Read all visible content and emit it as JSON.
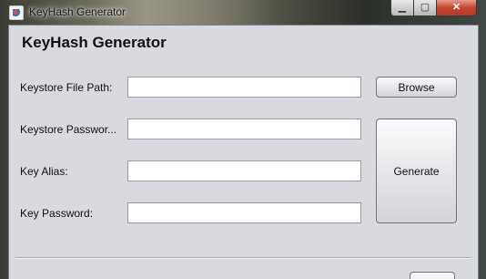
{
  "window": {
    "title": "KeyHash Generator",
    "controls": {
      "minimize": "▁",
      "maximize": "▢",
      "close": "✕"
    }
  },
  "form": {
    "heading": "KeyHash Generator",
    "fields": [
      {
        "label": "Keystore File Path:",
        "value": ""
      },
      {
        "label": "Keystore Passwor...",
        "value": ""
      },
      {
        "label": "Key Alias:",
        "value": ""
      },
      {
        "label": "Key Password:",
        "value": ""
      }
    ],
    "browse_label": "Browse",
    "generate_label": "Generate"
  }
}
